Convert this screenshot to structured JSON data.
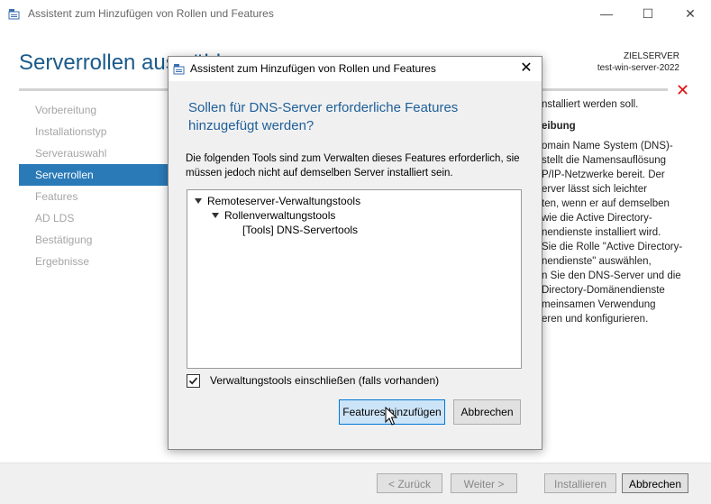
{
  "window": {
    "title": "Assistent zum Hinzufügen von Rollen und Features",
    "minimize": "—",
    "maximize": "☐",
    "close": "✕"
  },
  "header": {
    "page_title": "Serverrollen auswählen",
    "target_label": "ZIELSERVER",
    "target_server": "test-win-server-2022",
    "error_icon": "✕"
  },
  "nav": {
    "items": [
      {
        "label": "Vorbereitung"
      },
      {
        "label": "Installationstyp"
      },
      {
        "label": "Serverauswahl"
      },
      {
        "label": "Serverrollen"
      },
      {
        "label": "Features"
      },
      {
        "label": "AD LDS"
      },
      {
        "label": "Bestätigung"
      },
      {
        "label": "Ergebnisse"
      }
    ]
  },
  "description": {
    "intro": "nstalliert werden soll.",
    "heading": "eibung",
    "lines": [
      "omain Name System (DNS)-",
      "stellt die Namensauflösung",
      "P/IP-Netzwerke bereit. Der",
      "erver lässt sich leichter",
      "ten, wenn er auf demselben",
      "wie die Active Directory-",
      "nendienste installiert wird.",
      "Sie die Rolle \"Active Directory-",
      "nendienste\" auswählen,",
      "n Sie den DNS-Server und die",
      "Directory-Domänendienste",
      "meinsamen Verwendung",
      "eren und konfigurieren."
    ]
  },
  "footer": {
    "back": "< Zurück",
    "next": "Weiter >",
    "install": "Installieren",
    "cancel": "Abbrechen"
  },
  "dialog": {
    "title": "Assistent zum Hinzufügen von Rollen und Features",
    "close": "✕",
    "question": "Sollen für DNS-Server erforderliche Features hinzugefügt werden?",
    "text": "Die folgenden Tools sind zum Verwalten dieses Features erforderlich, sie müssen jedoch nicht auf demselben Server installiert sein.",
    "tree": [
      {
        "label": "Remoteserver-Verwaltungstools"
      },
      {
        "label": "Rollenverwaltungstools"
      },
      {
        "label": "[Tools] DNS-Servertools"
      }
    ],
    "checkbox_label": "Verwaltungstools einschließen (falls vorhanden)",
    "checkbox_checked": true,
    "add_button": "Features hinzufügen",
    "cancel_button": "Abbrechen"
  },
  "colors": {
    "accent": "#2a7ab8",
    "heading": "#1a5a8a",
    "error": "#e01010",
    "primary_button": "#cce4f7"
  }
}
